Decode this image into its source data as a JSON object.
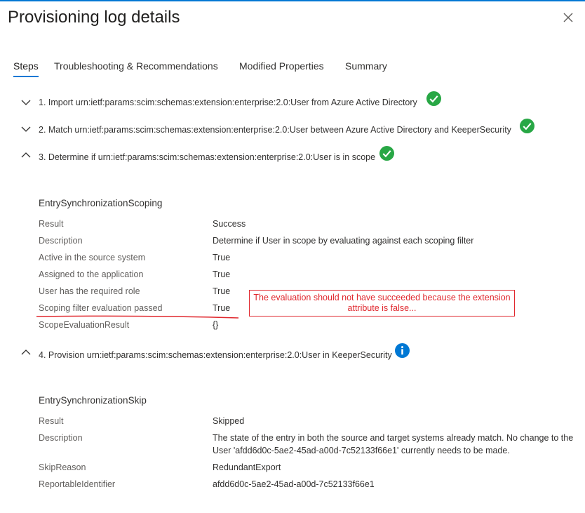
{
  "title": "Provisioning log details",
  "close_label": "close",
  "tabs": [
    {
      "label": "Steps",
      "active": true
    },
    {
      "label": "Troubleshooting & Recommendations",
      "active": false
    },
    {
      "label": "Modified Properties",
      "active": false
    },
    {
      "label": "Summary",
      "active": false
    }
  ],
  "steps": [
    {
      "text": "1. Import urn:ietf:params:scim:schemas:extension:enterprise:2.0:User from Azure Active Directory",
      "expanded": false,
      "status_icon": "success-check-icon"
    },
    {
      "text": "2. Match urn:ietf:params:scim:schemas:extension:enterprise:2.0:User between Azure Active Directory and KeeperSecurity",
      "expanded": false,
      "status_icon": "success-check-icon"
    },
    {
      "text": "3. Determine if urn:ietf:params:scim:schemas:extension:enterprise:2.0:User is in scope",
      "expanded": true,
      "status_icon": "success-check-icon"
    },
    {
      "text": "4. Provision urn:ietf:params:scim:schemas:extension:enterprise:2.0:User in KeeperSecurity",
      "expanded": true,
      "status_icon": "info-icon"
    }
  ],
  "scoping": {
    "title": "EntrySynchronizationScoping",
    "rows": [
      {
        "label": "Result",
        "value": "Success"
      },
      {
        "label": "Description",
        "value": "Determine if User in scope by evaluating against each scoping filter"
      },
      {
        "label": "Active in the source system",
        "value": "True"
      },
      {
        "label": "Assigned to the application",
        "value": "True"
      },
      {
        "label": "User has the required role",
        "value": "True"
      },
      {
        "label": "Scoping filter evaluation passed",
        "value": "True"
      },
      {
        "label": "ScopeEvaluationResult",
        "value": "{}"
      }
    ]
  },
  "annotation": {
    "text": "The evaluation should not have succeeded because the extension attribute is false..."
  },
  "skip": {
    "title": "EntrySynchronizationSkip",
    "rows": [
      {
        "label": "Result",
        "value": "Skipped"
      },
      {
        "label": "Description",
        "value": "The state of the entry in both the source and target systems already match. No change to the User 'afdd6d0c-5ae2-45ad-a00d-7c52133f66e1' currently needs to be made."
      },
      {
        "label": "SkipReason",
        "value": "RedundantExport"
      },
      {
        "label": "ReportableIdentifier",
        "value": "afdd6d0c-5ae2-45ad-a00d-7c52133f66e1"
      }
    ]
  },
  "colors": {
    "accent": "#0078d4",
    "success": "#28a745",
    "annotation": "#e0282e"
  }
}
